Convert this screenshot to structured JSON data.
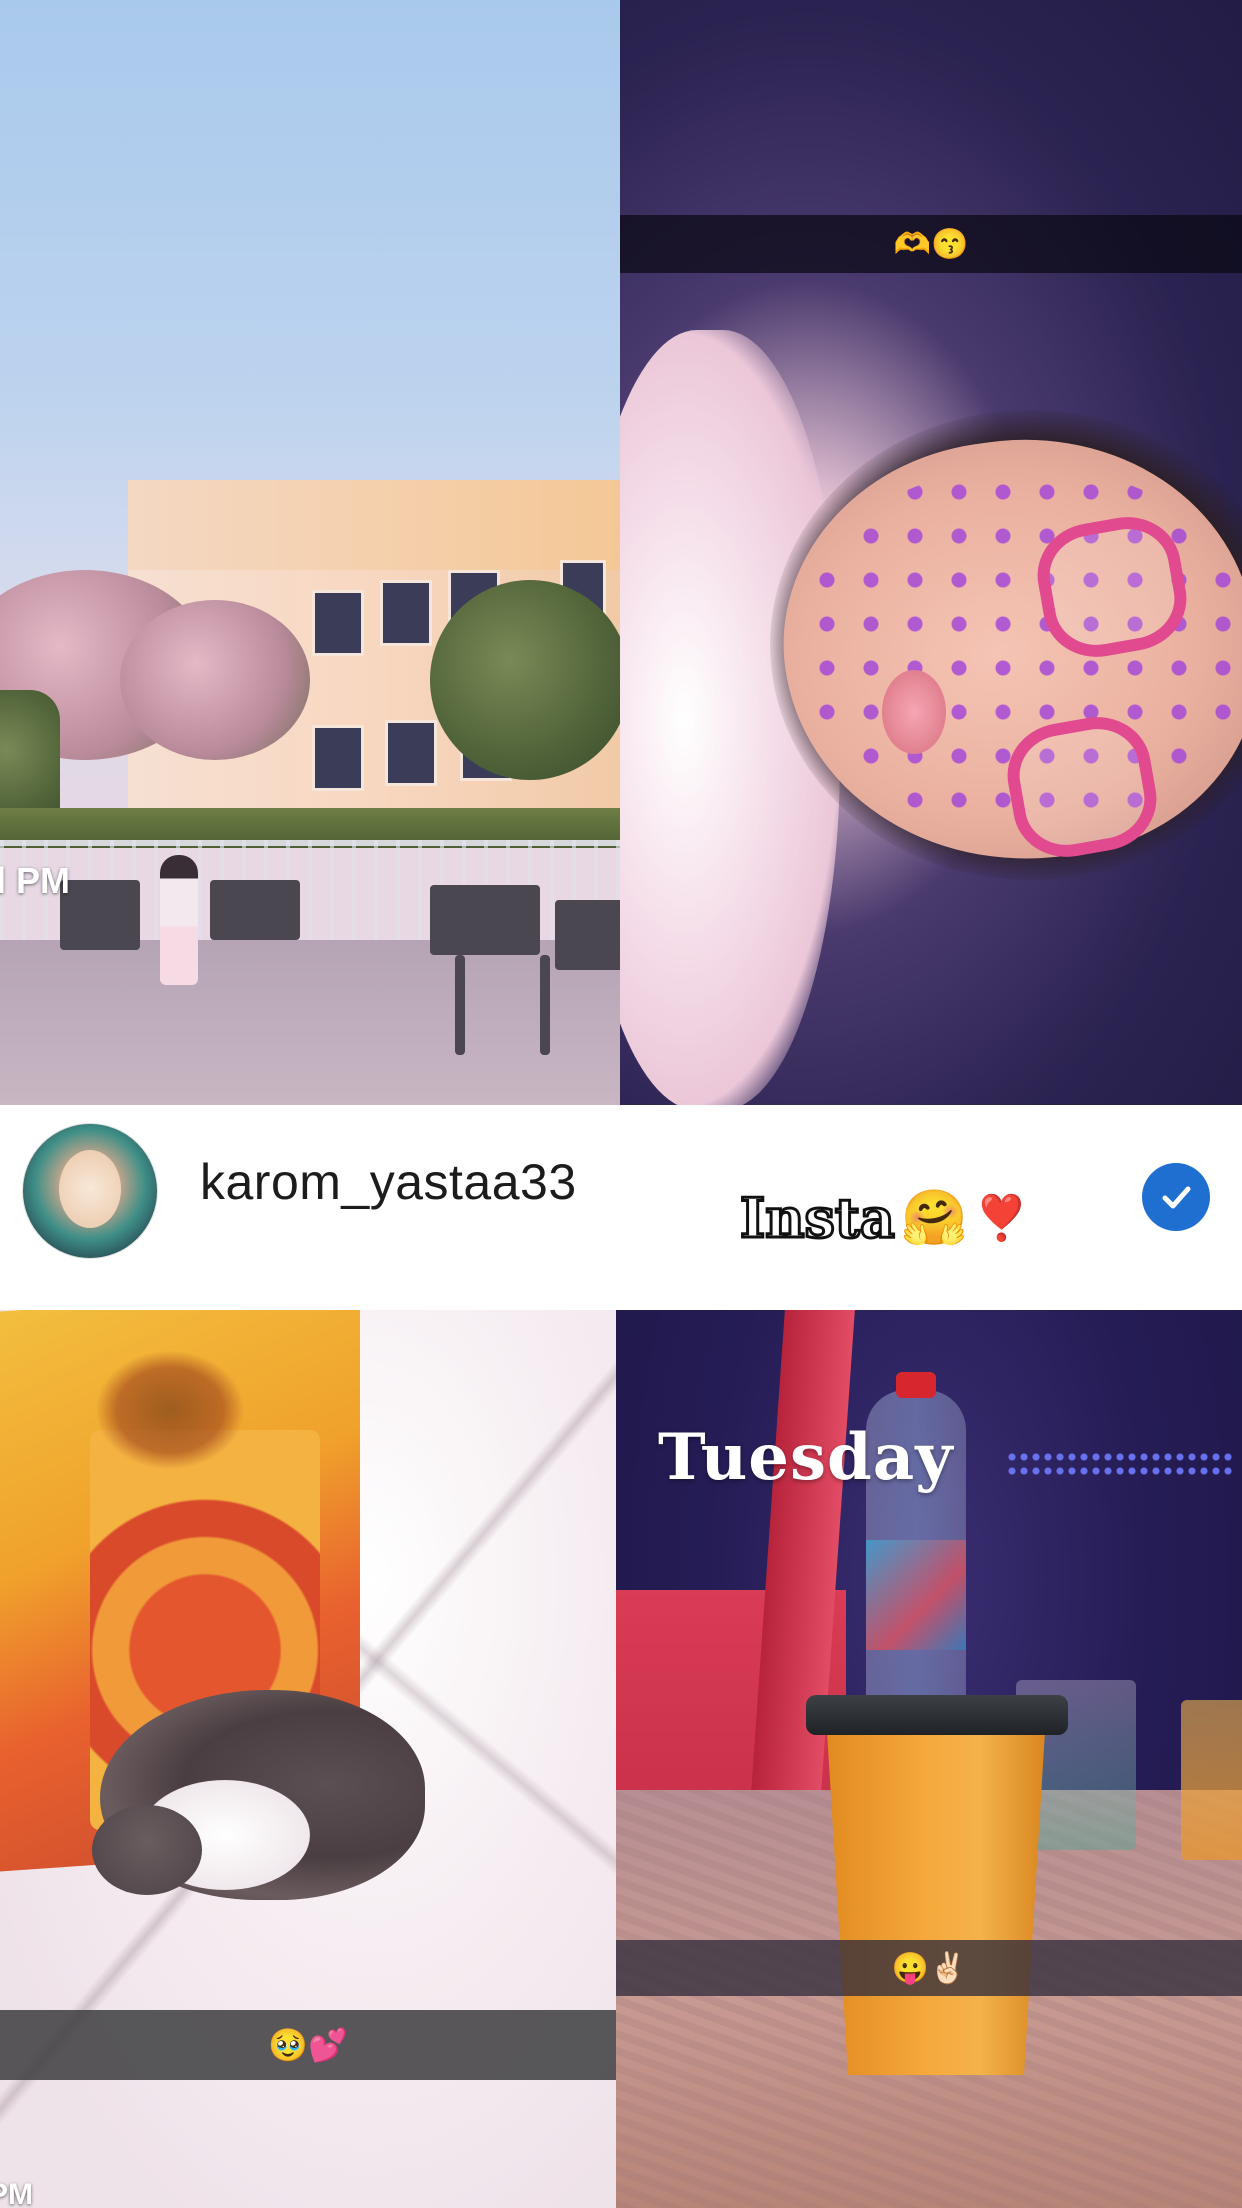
{
  "tiles": {
    "top_left": {
      "overlay_text": "ll PM"
    },
    "top_right": {
      "caption_emojis": "🫶😙"
    },
    "bottom_left": {
      "caption_emojis": "🥹💕",
      "corner_text": "PM"
    },
    "bottom_right": {
      "day_label": "Tuesday",
      "caption_emojis": "😛✌🏻"
    }
  },
  "post_header": {
    "username": "karom_yastaa33",
    "caption_text": "Insta",
    "caption_emoji_hug": "🤗",
    "caption_emoji_heart": "❣️",
    "avatar_icon": "profile-avatar",
    "verified_icon": "check-badge-icon",
    "verified_color": "#1f6fd1"
  }
}
